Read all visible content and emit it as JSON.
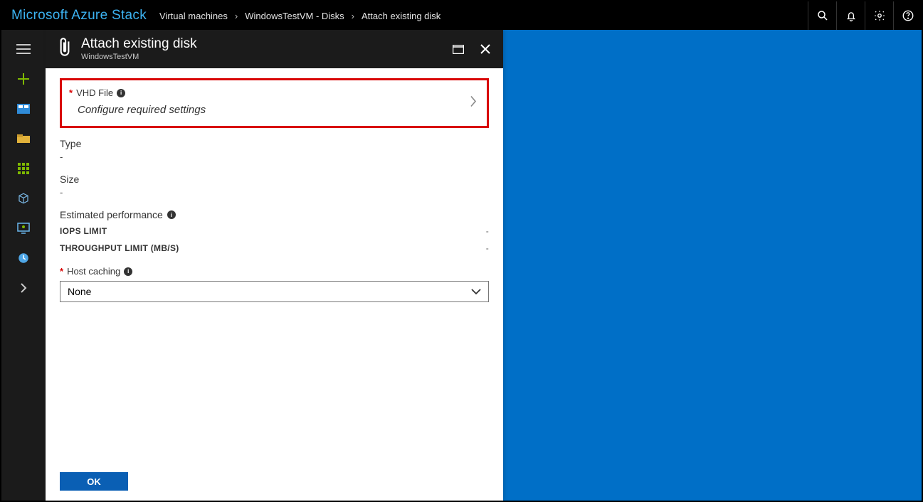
{
  "header": {
    "brand": "Microsoft Azure Stack",
    "breadcrumbs": [
      {
        "label": "Virtual machines"
      },
      {
        "label": "WindowsTestVM - Disks"
      },
      {
        "label": "Attach existing disk"
      }
    ]
  },
  "blade": {
    "title": "Attach existing disk",
    "subtitle": "WindowsTestVM",
    "vhd": {
      "label": "VHD File",
      "action": "Configure required settings"
    },
    "type": {
      "label": "Type",
      "value": "-"
    },
    "size": {
      "label": "Size",
      "value": "-"
    },
    "performance": {
      "heading": "Estimated performance",
      "rows": [
        {
          "label": "IOPS LIMIT",
          "value": "-"
        },
        {
          "label": "THROUGHPUT LIMIT (MB/S)",
          "value": "-"
        }
      ]
    },
    "hostCaching": {
      "label": "Host caching",
      "selected": "None"
    },
    "okLabel": "OK"
  }
}
